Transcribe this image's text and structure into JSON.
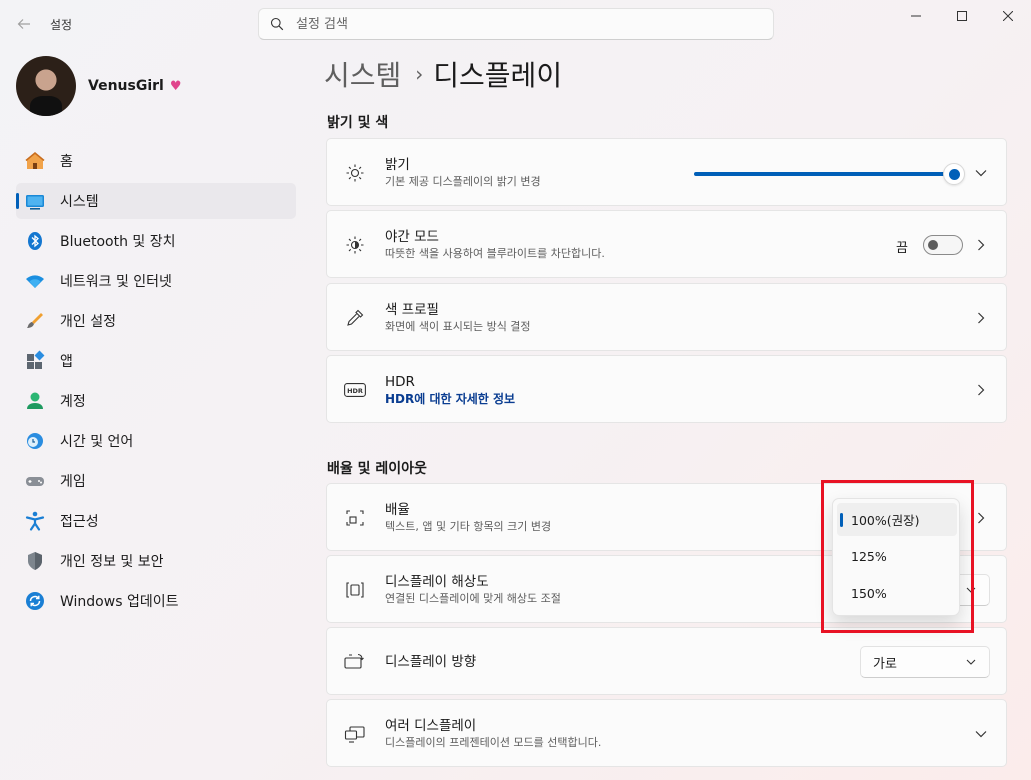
{
  "app": {
    "title": "설정"
  },
  "search": {
    "placeholder": "설정 검색"
  },
  "profile": {
    "name": "VenusGirl"
  },
  "sidebar": {
    "items": [
      {
        "label": "홈",
        "icon": "home-icon"
      },
      {
        "label": "시스템",
        "icon": "system-icon",
        "active": true
      },
      {
        "label": "Bluetooth 및 장치",
        "icon": "bluetooth-icon"
      },
      {
        "label": "네트워크 및 인터넷",
        "icon": "wifi-icon"
      },
      {
        "label": "개인 설정",
        "icon": "brush-icon"
      },
      {
        "label": "앱",
        "icon": "apps-icon"
      },
      {
        "label": "계정",
        "icon": "account-icon"
      },
      {
        "label": "시간 및 언어",
        "icon": "clock-globe-icon"
      },
      {
        "label": "게임",
        "icon": "gamepad-icon"
      },
      {
        "label": "접근성",
        "icon": "accessibility-icon"
      },
      {
        "label": "개인 정보 및 보안",
        "icon": "shield-icon"
      },
      {
        "label": "Windows 업데이트",
        "icon": "update-icon"
      }
    ]
  },
  "breadcrumb": {
    "parent": "시스템",
    "separator": "›",
    "current": "디스플레이"
  },
  "sections": {
    "brightness_color": "밝기 및 색",
    "scale_layout": "배율 및 레이아웃"
  },
  "cards": {
    "brightness": {
      "title": "밝기",
      "subtitle": "기본 제공 디스플레이의 밝기 변경",
      "value": 1.0
    },
    "night_light": {
      "title": "야간 모드",
      "subtitle": "따뜻한 색을 사용하여 블루라이트를 차단합니다.",
      "state": "끔"
    },
    "color_profile": {
      "title": "색 프로필",
      "subtitle": "화면에 색이 표시되는 방식 결정"
    },
    "hdr": {
      "title": "HDR",
      "link": "HDR에 대한 자세한 정보"
    },
    "scale": {
      "title": "배율",
      "subtitle": "텍스트, 앱 및 기타 항목의 크기 변경"
    },
    "resolution": {
      "title": "디스플레이 해상도",
      "subtitle": "연결된 디스플레이에 맞게 해상도 조절"
    },
    "orientation": {
      "title": "디스플레이 방향",
      "value": "가로"
    },
    "multiple_displays": {
      "title": "여러 디스플레이",
      "subtitle": "디스플레이의 프레젠테이션 모드를 선택합니다."
    }
  },
  "scale_dropdown": {
    "options": [
      "100%(권장)",
      "125%",
      "150%"
    ],
    "selected": "100%(권장)"
  },
  "colors": {
    "accent": "#005fb8",
    "highlight_box": "#e81224"
  }
}
